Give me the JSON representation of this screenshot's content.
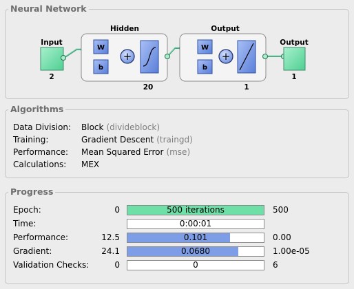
{
  "network": {
    "section_title": "Neural Network",
    "input": {
      "label": "Input",
      "size": "2"
    },
    "hidden": {
      "label": "Hidden",
      "size": "20",
      "weight": "W",
      "bias": "b",
      "sum": "+"
    },
    "output_layer": {
      "label": "Output",
      "size": "1",
      "weight": "W",
      "bias": "b",
      "sum": "+"
    },
    "output": {
      "label": "Output",
      "size": "1"
    }
  },
  "algorithms": {
    "section_title": "Algorithms",
    "rows": [
      {
        "key": "Data Division:",
        "value": "Block",
        "fn": "(divideblock)"
      },
      {
        "key": "Training:",
        "value": "Gradient Descent",
        "fn": "(traingd)"
      },
      {
        "key": "Performance:",
        "value": "Mean Squared Error",
        "fn": "(mse)"
      },
      {
        "key": "Calculations:",
        "value": "MEX",
        "fn": ""
      }
    ]
  },
  "progress": {
    "section_title": "Progress",
    "rows": [
      {
        "label": "Epoch:",
        "min": "0",
        "text": "500 iterations",
        "max": "500",
        "fill": 1.0,
        "color": "#6ddfa7"
      },
      {
        "label": "Time:",
        "min": "",
        "text": "0:00:01",
        "max": "",
        "fill": 0,
        "color": ""
      },
      {
        "label": "Performance:",
        "min": "12.5",
        "text": "0.101",
        "max": "0.00",
        "fill": 0.755,
        "color": "#7d9ee6"
      },
      {
        "label": "Gradient:",
        "min": "24.1",
        "text": "0.0680",
        "max": "1.00e-05",
        "fill": 0.815,
        "color": "#7d9ee6"
      },
      {
        "label": "Validation Checks:",
        "min": "0",
        "text": "0",
        "max": "6",
        "fill": 0,
        "color": ""
      }
    ]
  }
}
